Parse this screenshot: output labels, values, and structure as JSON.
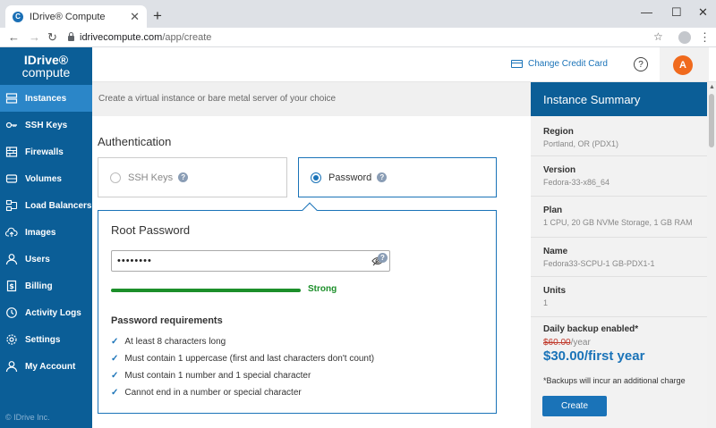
{
  "browser": {
    "tab_title": "IDrive® Compute",
    "favicon_letter": "C",
    "new_tab": "+",
    "url_host": "idrivecompute.com",
    "url_path": "/app/create"
  },
  "sidebar": {
    "logo_top": "IDrive®",
    "logo_bottom": "compute",
    "items": [
      {
        "label": "Instances",
        "icon": "server-icon"
      },
      {
        "label": "SSH Keys",
        "icon": "key-icon"
      },
      {
        "label": "Firewalls",
        "icon": "firewall-icon"
      },
      {
        "label": "Volumes",
        "icon": "volume-icon"
      },
      {
        "label": "Load Balancers",
        "icon": "load-balancer-icon"
      },
      {
        "label": "Images",
        "icon": "cloud-upload-icon"
      },
      {
        "label": "Users",
        "icon": "user-icon"
      },
      {
        "label": "Billing",
        "icon": "billing-icon"
      },
      {
        "label": "Activity Logs",
        "icon": "history-icon"
      },
      {
        "label": "Settings",
        "icon": "gear-icon"
      },
      {
        "label": "My Account",
        "icon": "account-icon"
      }
    ],
    "copyright": "© IDrive Inc."
  },
  "header": {
    "change_cc": "Change Credit Card",
    "help": "?",
    "avatar": "A"
  },
  "main": {
    "subtitle": "Create a virtual instance or bare metal server of your choice",
    "auth_title": "Authentication",
    "options": {
      "ssh": "SSH Keys",
      "password": "Password"
    },
    "root_title": "Root Password",
    "password_value": "••••••••",
    "strength": "Strong",
    "strength_fraction": 1.0,
    "req_title": "Password requirements",
    "requirements": [
      "At least 8 characters long",
      "Must contain 1 uppercase (first and last characters don't count)",
      "Must contain 1 number and 1 special character",
      "Cannot end in a number or special character"
    ]
  },
  "summary": {
    "title": "Instance Summary",
    "region_label": "Region",
    "region_value": "Portland, OR (PDX1)",
    "version_label": "Version",
    "version_value": "Fedora-33-x86_64",
    "plan_label": "Plan",
    "plan_value": "1 CPU, 20 GB NVMe Storage, 1 GB RAM",
    "name_label": "Name",
    "name_value": "Fedora33-SCPU-1 GB-PDX1-1",
    "units_label": "Units",
    "units_value": "1",
    "backup_label": "Daily backup enabled*",
    "old_price": "$60.00",
    "old_price_suffix": "/year",
    "new_price": "$30.00/first year",
    "backup_note": "*Backups will incur an additional charge",
    "create": "Create"
  }
}
